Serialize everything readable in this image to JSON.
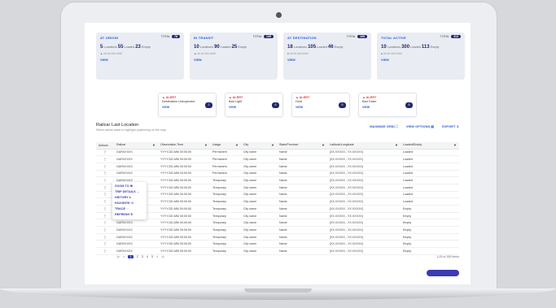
{
  "cards": [
    {
      "title": "AT ORIGIN",
      "total": "TOTAL",
      "total_val": "78",
      "n1": "5",
      "l1": "Locations",
      "n2": "55",
      "l2": "Loaded",
      "n3": "23",
      "l3": "Empty",
      "warn": "##  ##  ###  ####",
      "view": "VIEW"
    },
    {
      "title": "IN TRANSIT",
      "total": "TOTAL",
      "total_val": "135",
      "n1": "10",
      "l1": "Locations",
      "n2": "90",
      "l2": "Loaded",
      "n3": "25",
      "l3": "Empty",
      "warn": "##  ##  ###  ####",
      "view": "VIEW"
    },
    {
      "title": "AT DESTINATION",
      "total": "TOTAL",
      "total_val": "169",
      "n1": "18",
      "l1": "Locations",
      "n2": "105",
      "l2": "Loaded",
      "n3": "46",
      "l3": "Empty",
      "warn": "##  ##  ###  ####",
      "view": "VIEW"
    },
    {
      "title": "TOTAL ACTIVE",
      "total": "TOTAL",
      "total_val": "413",
      "n1": "10",
      "l1": "Locations",
      "n2": "300",
      "l2": "Loaded",
      "n3": "113",
      "l3": "Empty",
      "warn": "##  ##  ###  ####",
      "view": "VIEW"
    }
  ],
  "alerts": [
    {
      "title": "ALERT",
      "name": "Destination Unexpected",
      "view": "VIEW",
      "count": "2"
    },
    {
      "title": "ALERT",
      "name": "Bad Light",
      "view": "VIEW",
      "count": "6"
    },
    {
      "title": "ALERT",
      "name": "Hold",
      "view": "VIEW",
      "count": "5"
    },
    {
      "title": "ALERT",
      "name": "Bad Order",
      "view": "VIEW",
      "count": "8"
    }
  ],
  "table": {
    "title": "Railcar Last Location",
    "subtitle": "Select railcar asset to highlight positioning on the map",
    "maximize": "MAXIMIZE GRID",
    "view_options": "VIEW OPTIONS",
    "export": "EXPORT",
    "columns": [
      "Actions",
      "Railcar",
      "Observation Time",
      "Usage",
      "City",
      "State/Province",
      "Latitude/Longitude",
      "Loaded/Empty"
    ],
    "rows": [
      [
        "GARXXXXX",
        "YYYY-DD-MM 00:00:00",
        "Permanent",
        "City name",
        "Name",
        "[XX.XXXXX, -YX.XXXXX]",
        "Loaded"
      ],
      [
        "GARXXXXX",
        "YYYY-DD-MM 00:00:00",
        "Permanent",
        "City name",
        "Name",
        "[XX.XXXXX, -YX.XXXXX]",
        "Loaded"
      ],
      [
        "GARXXXXX",
        "YYYY-DD-MM 00:00:00",
        "Permanent",
        "City name",
        "Name",
        "[XX.XXXXX, -YX.XXXXX]",
        "Loaded"
      ],
      [
        "GARXXXXX",
        "YYYY-DD-MM 00:00:00",
        "Permanent",
        "City name",
        "Name",
        "[XX.XXXXX, -YX.XXXXX]",
        "Loaded"
      ],
      [
        "GARXXXXX",
        "YYYY-DD-MM 00:00:00",
        "Temporary",
        "City name",
        "Name",
        "[XX.XXXXX, -YX.XXXXX]",
        "Loaded"
      ],
      [
        "GARXXXXX",
        "YYYY-DD-MM 00:00:00",
        "Temporary",
        "City name",
        "Name",
        "[XX.XXXXX, -YX.XXXXX]",
        "Loaded"
      ],
      [
        "GARXXXXX",
        "YYYY-DD-MM 00:00:00",
        "Temporary",
        "City name",
        "Name",
        "[XX.XXXXX, -YX.XXXXX]",
        "Loaded"
      ],
      [
        "GARXXXXX",
        "YYYY-DD-MM 00:00:00",
        "Temporary",
        "City name",
        "Name",
        "[XX.XXXXX, -YX.XXXXX]",
        "Loaded"
      ],
      [
        "GARXXXXX",
        "YYYY-DD-MM 00:00:00",
        "Temporary",
        "City name",
        "Name",
        "[XX.XXXXX, -YX.XXXXX]",
        "Empty"
      ],
      [
        "GARXXXXX",
        "YYYY-DD-MM 00:00:00",
        "Temporary",
        "City name",
        "Name",
        "[XX.XXXXX, -YX.XXXXX]",
        "Empty"
      ],
      [
        "GARXXXXX",
        "YYYY-DD-MM 00:00:00",
        "Temporary",
        "City name",
        "Name",
        "[XX.XXXXX, -YX.XXXXX]",
        "Empty"
      ],
      [
        "GARXXXXX",
        "YYYY-DD-MM 00:00:00",
        "Temporary",
        "City name",
        "Name",
        "[XX.XXXXX, -YX.XXXXX]",
        "Empty"
      ],
      [
        "GARXXXXX",
        "YYYY-DD-MM 00:00:00",
        "Temporary",
        "City name",
        "Name",
        "[XX.XXXXX, -YX.XXXXX]",
        "Empty"
      ],
      [
        "GARXXXXX",
        "YYYY-DD-MM 00:00:00",
        "Temporary",
        "City name",
        "Name",
        "[XX.XXXXX, -YX.XXXXX]",
        "Empty"
      ],
      [
        "GARXXXXX",
        "YYYY-DD-MM 00:00:00",
        "Temporary",
        "City name",
        "Name",
        "[XX.XXXXX, -YX.XXXXX]",
        "Empty"
      ]
    ]
  },
  "menu": [
    "ZOOM TO",
    "TRIP DETAILS",
    "HISTORY",
    "FAVORITE",
    "TRACE",
    "REFRESH"
  ],
  "pager": {
    "first": "|<",
    "prev": "<",
    "pages": [
      "1",
      "2",
      "3",
      "4",
      "5"
    ],
    "current": "1",
    "next": ">",
    "last": ">|",
    "range": "1-25 of 150 items"
  }
}
